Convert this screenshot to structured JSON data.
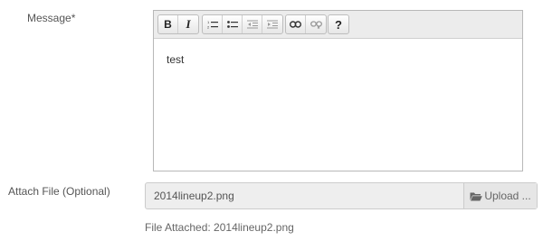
{
  "message": {
    "label": "Message*",
    "toolbar": {
      "bold": "B",
      "italic": "I",
      "help": "?"
    },
    "content": "test"
  },
  "attach": {
    "label": "Attach File (Optional)",
    "file_name": "2014lineup2.png",
    "upload_label": "Upload ...",
    "attached_text": "File Attached: 2014lineup2.png"
  }
}
